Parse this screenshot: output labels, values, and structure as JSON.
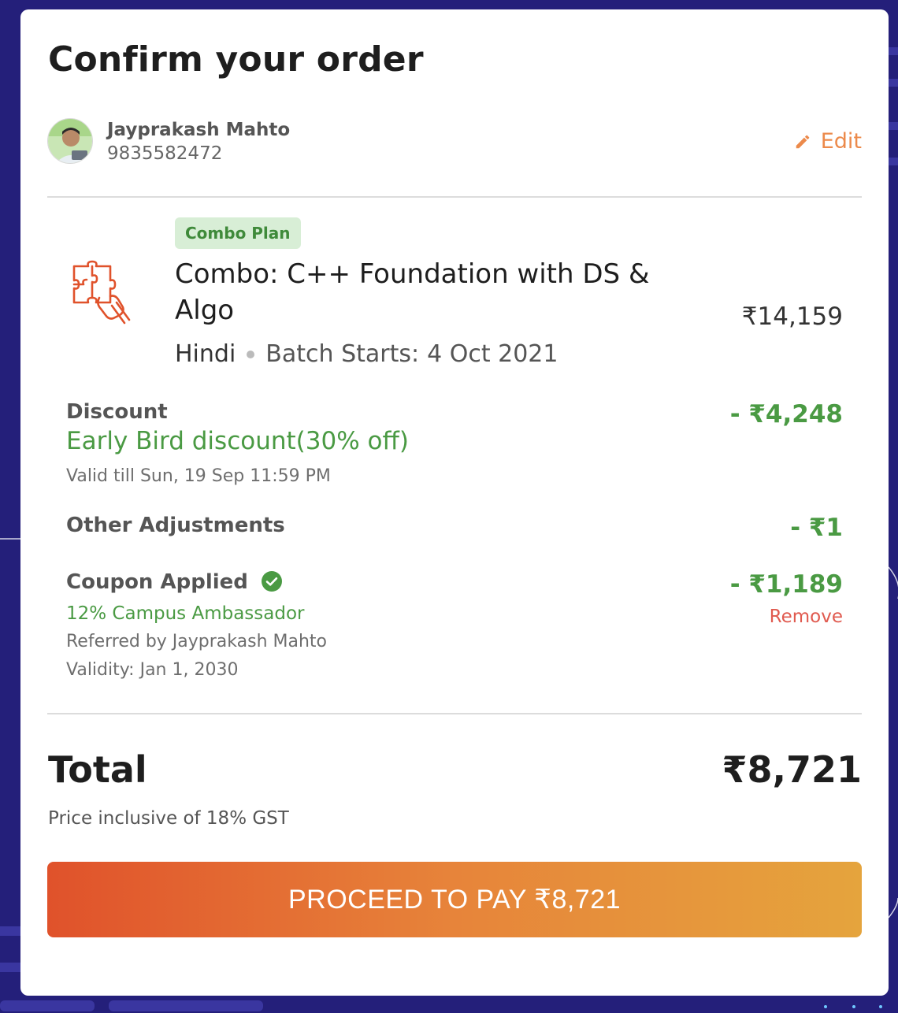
{
  "page": {
    "title": "Confirm your order"
  },
  "user": {
    "name": "Jayprakash Mahto",
    "phone": "9835582472",
    "edit_label": "Edit"
  },
  "course": {
    "badge": "Combo Plan",
    "title": "Combo: C++ Foundation with DS & Algo",
    "language": "Hindi",
    "batch_label": "Batch Starts:",
    "batch_date": "4 Oct 2021",
    "price": "₹14,159"
  },
  "discount": {
    "label": "Discount",
    "name": "Early Bird discount(30% off)",
    "validity": "Valid till Sun, 19 Sep 11:59 PM",
    "amount": "- ₹4,248"
  },
  "adjustments": {
    "label": "Other Adjustments",
    "amount": "- ₹1"
  },
  "coupon": {
    "label": "Coupon Applied",
    "code": "12% Campus Ambassador",
    "referred_by": "Referred by Jayprakash Mahto",
    "validity": "Validity: Jan 1, 2030",
    "amount": "- ₹1,189",
    "remove_label": "Remove"
  },
  "total": {
    "label": "Total",
    "amount": "₹8,721",
    "gst_note": "Price inclusive of 18% GST"
  },
  "pay_button": {
    "label": "PROCEED TO PAY ₹8,721"
  },
  "colors": {
    "accent_orange": "#ec8a4b",
    "discount_green": "#4a9a43",
    "remove_red": "#e05a4f",
    "background_navy": "#241f7a"
  },
  "icons": {
    "edit": "pencil-icon",
    "course": "puzzle-icon",
    "coupon_status": "check-circle-icon"
  }
}
